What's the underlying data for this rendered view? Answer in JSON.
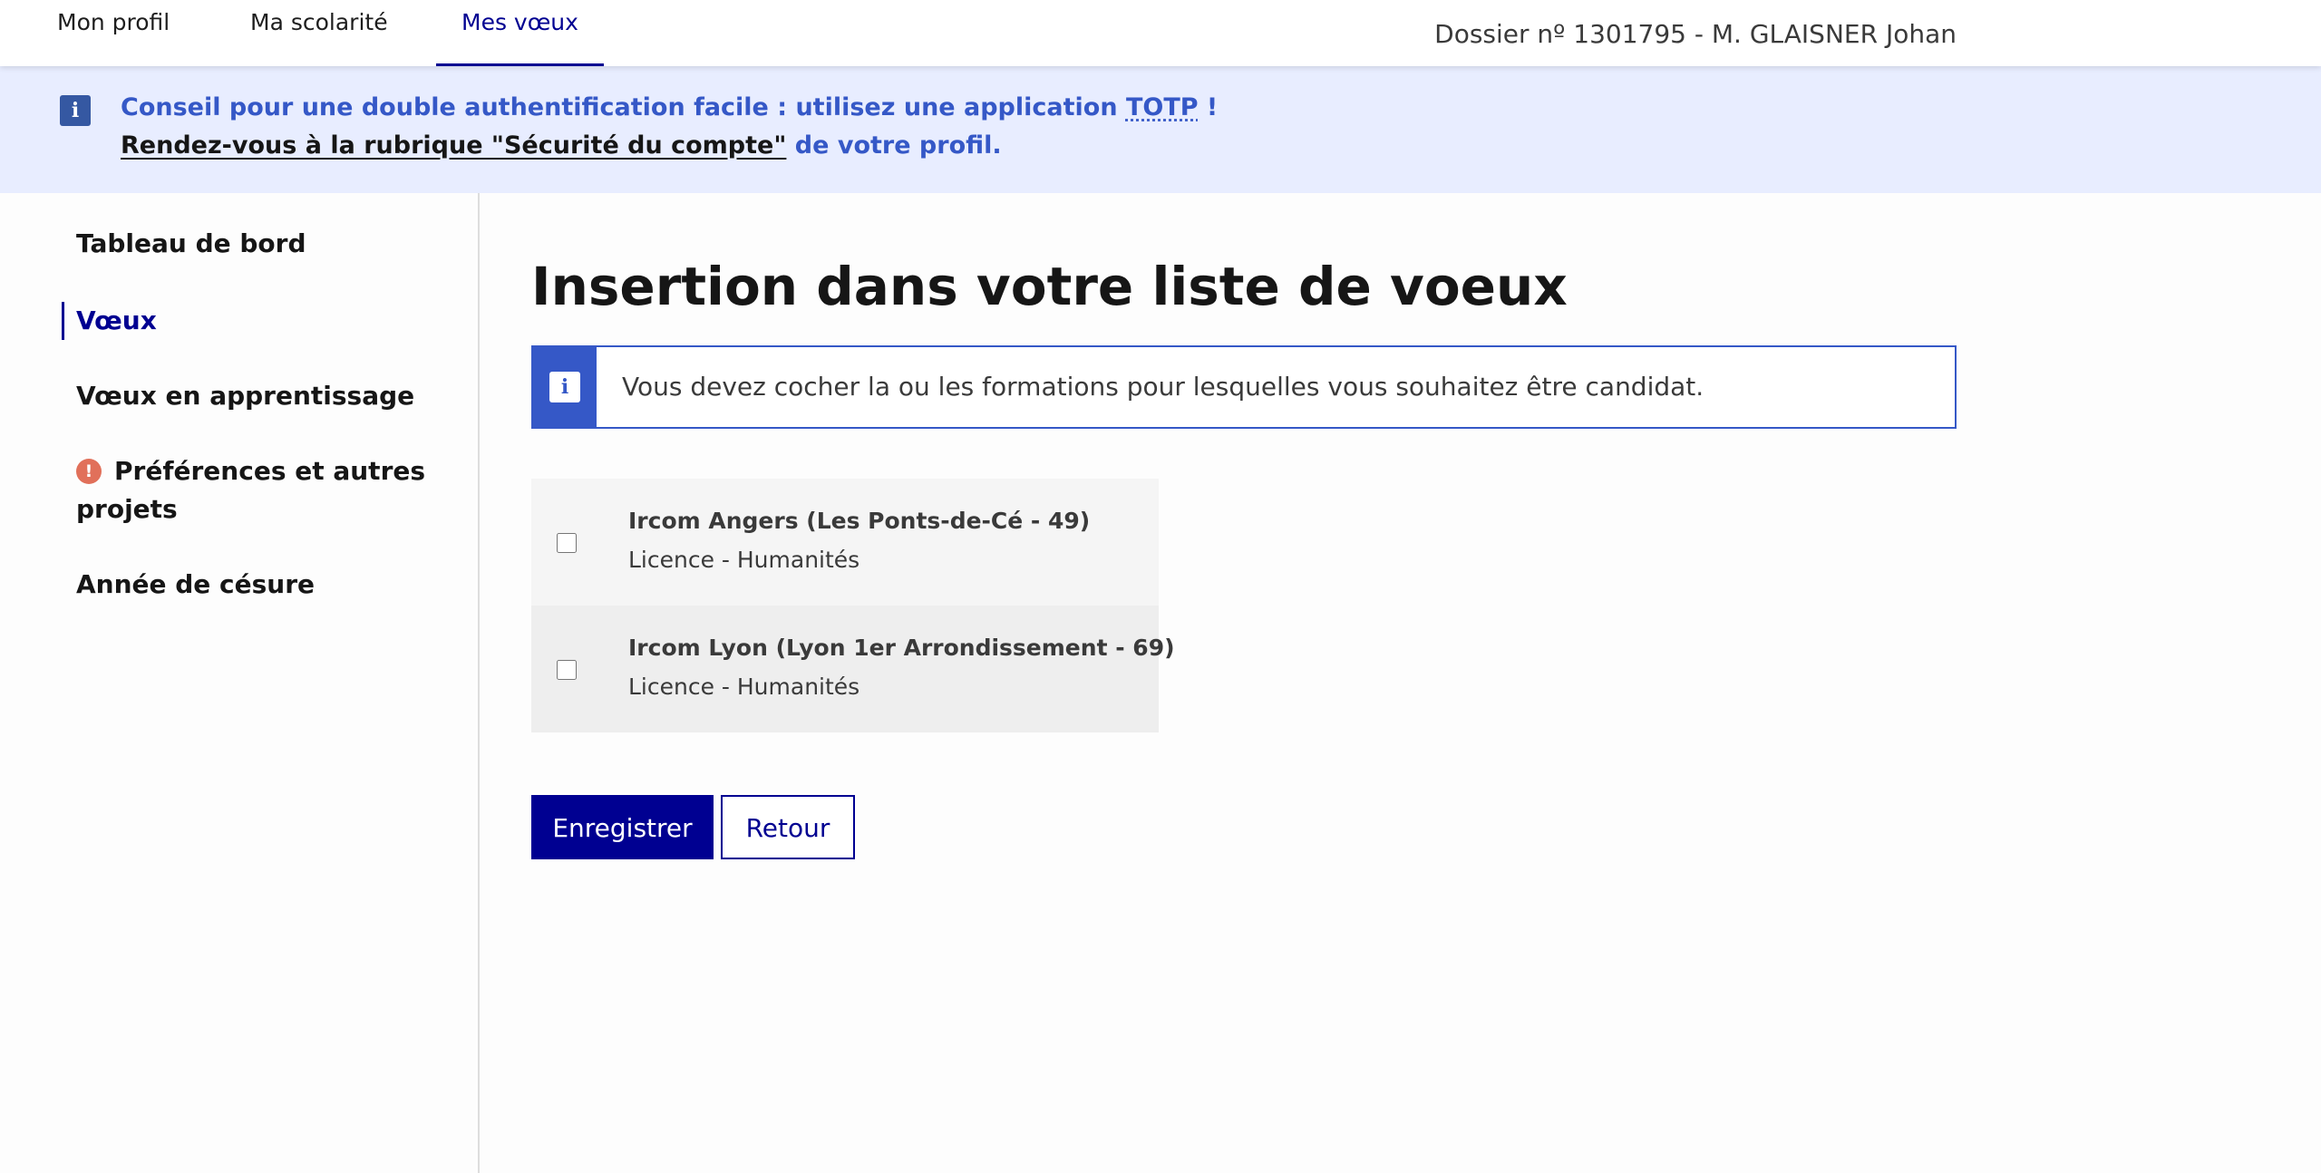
{
  "nav": {
    "tabs": [
      {
        "label": "Mon profil"
      },
      {
        "label": "Ma scolarité"
      },
      {
        "label": "Mes vœux",
        "active": true
      }
    ],
    "dossier": "Dossier nº 1301795 - M. GLAISNER Johan"
  },
  "banner": {
    "icon": "info-icon",
    "line1_prefix": "Conseil pour une double authentification facile : utilisez une application ",
    "line1_abbr": "TOTP",
    "line1_suffix": " !",
    "line2_link": "Rendez-vous à la rubrique \"Sécurité du compte\"",
    "line2_suffix": " de votre profil."
  },
  "sidebar": {
    "items": [
      {
        "label": "Tableau de bord"
      },
      {
        "label": "Vœux",
        "active": true
      },
      {
        "label": "Vœux en apprentissage"
      },
      {
        "label_line1": "Préférences et autres",
        "label_line2": "projets",
        "icon": "warning-icon"
      },
      {
        "label": "Année de césure"
      }
    ]
  },
  "main": {
    "title": "Insertion dans votre liste de voeux",
    "notice": "Vous devez cocher la ou les formations pour lesquelles vous souhaitez être candidat.",
    "choices": [
      {
        "name": "Ircom Angers (Les Ponts-de-Cé - 49)",
        "formation": "Licence - Humanités",
        "checked": false
      },
      {
        "name": "Ircom Lyon (Lyon 1er Arrondissement - 69)",
        "formation": "Licence - Humanités",
        "checked": false
      }
    ],
    "save_label": "Enregistrer",
    "back_label": "Retour"
  },
  "colors": {
    "primary": "#000091",
    "info": "#3558c7",
    "banner_bg": "#e8edff",
    "warning": "#e1705a"
  }
}
